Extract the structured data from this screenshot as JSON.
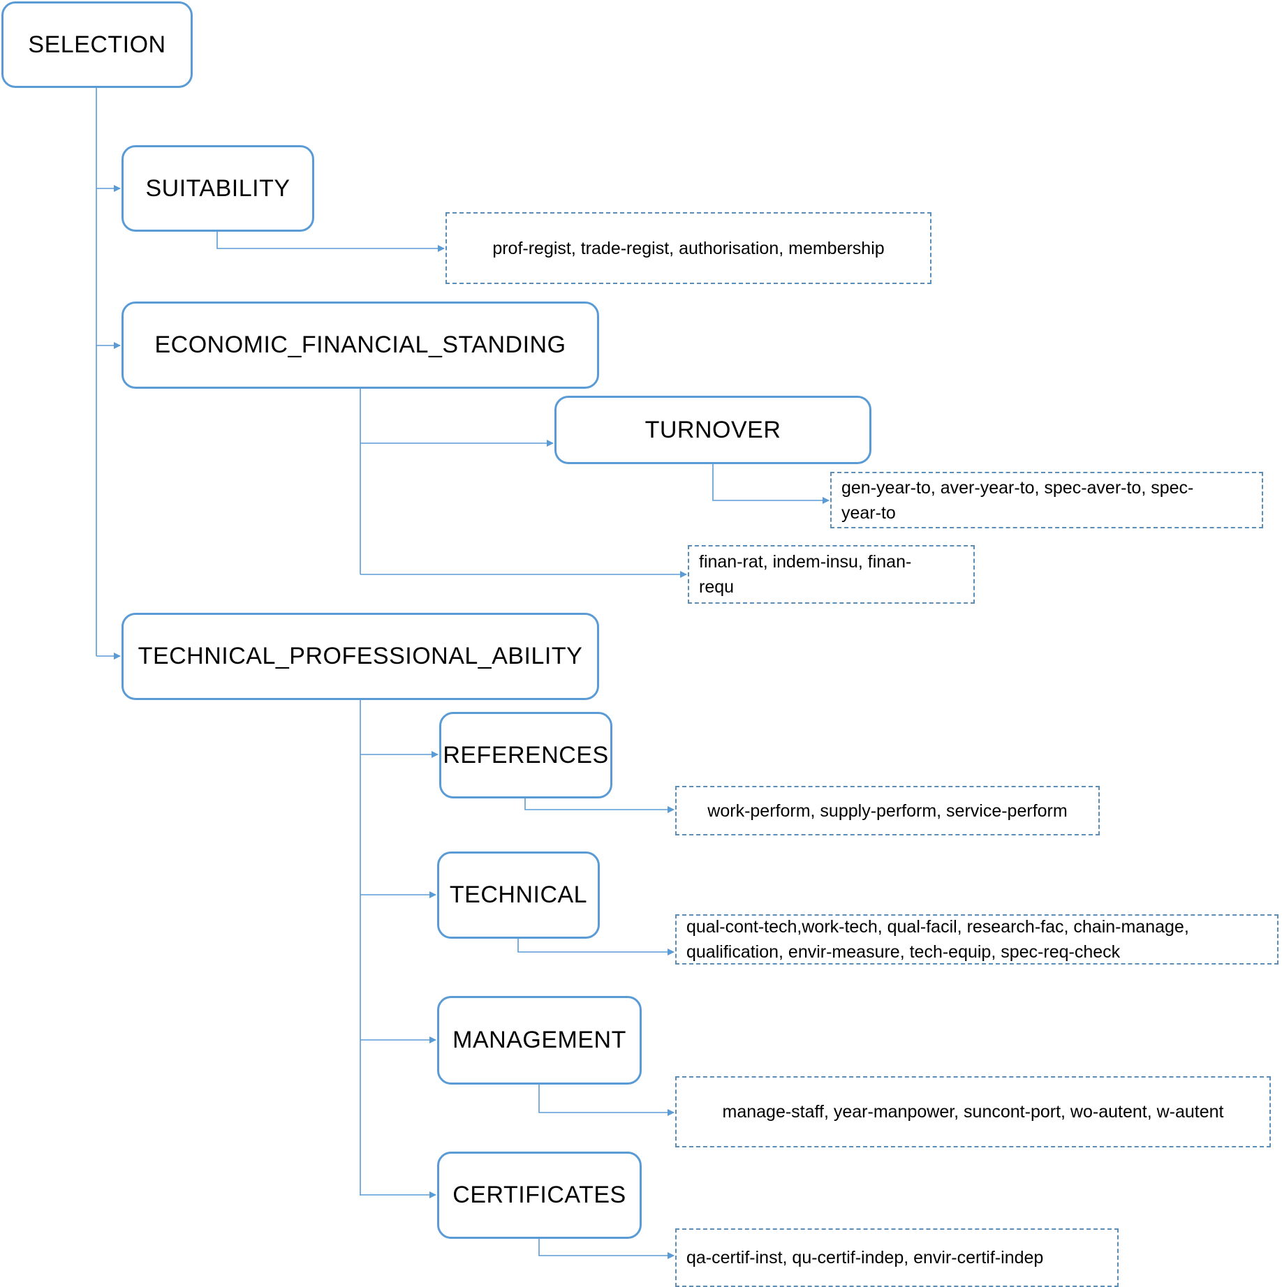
{
  "diagram": {
    "type": "hierarchy-tree",
    "colors": {
      "node_border": "#5b9bd5",
      "leaf_border": "#5b8db9",
      "connector": "#5b9bd5"
    },
    "root": {
      "label": "SELECTION",
      "children": [
        {
          "label": "SUITABILITY",
          "leaf": "prof-regist, trade-regist, authorisation, membership"
        },
        {
          "label": "ECONOMIC_FINANCIAL_STANDING",
          "children": [
            {
              "label": "TURNOVER",
              "leaf": "gen-year-to, aver-year-to, spec-aver-to, spec-year-to"
            }
          ],
          "leaf": "finan-rat, indem-insu, finan-requ"
        },
        {
          "label": "TECHNICAL_PROFESSIONAL_ABILITY",
          "children": [
            {
              "label": "REFERENCES",
              "leaf": "work-perform, supply-perform, service-perform"
            },
            {
              "label": "TECHNICAL",
              "leaf": "qual-cont-tech,work-tech, qual-facil, research-fac, chain-manage, qualification, envir-measure, tech-equip, spec-req-check"
            },
            {
              "label": "MANAGEMENT",
              "leaf": "manage-staff, year-manpower, suncont-port, wo-autent, w-autent"
            },
            {
              "label": "CERTIFICATES",
              "leaf": "qa-certif-inst, qu-certif-indep, envir-certif-indep"
            }
          ]
        }
      ]
    }
  }
}
